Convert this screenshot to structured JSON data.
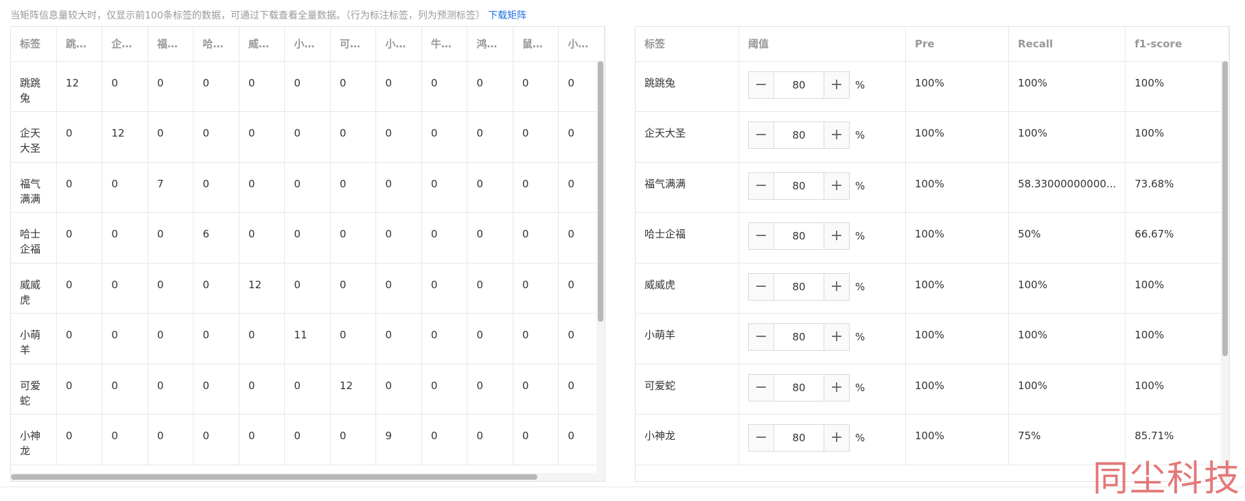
{
  "notice": {
    "text": "当矩阵信息量较大时，仅显示前100条标签的数据，可通过下载查看全量数据。（行为标注标签，列为预测标签）",
    "link": "下载矩阵"
  },
  "matrix": {
    "header_label": "标签",
    "columns": [
      "跳…",
      "企…",
      "福…",
      "哈…",
      "威…",
      "小…",
      "可…",
      "小…",
      "牛…",
      "鸿…",
      "鼠…",
      "小…"
    ],
    "rows": [
      {
        "label": "跳跳兔",
        "values": [
          "12",
          "0",
          "0",
          "0",
          "0",
          "0",
          "0",
          "0",
          "0",
          "0",
          "0",
          "0"
        ]
      },
      {
        "label": "企天大圣",
        "values": [
          "0",
          "12",
          "0",
          "0",
          "0",
          "0",
          "0",
          "0",
          "0",
          "0",
          "0",
          "0"
        ]
      },
      {
        "label": "福气满满",
        "values": [
          "0",
          "0",
          "7",
          "0",
          "0",
          "0",
          "0",
          "0",
          "0",
          "0",
          "0",
          "0"
        ]
      },
      {
        "label": "哈士企福",
        "values": [
          "0",
          "0",
          "0",
          "6",
          "0",
          "0",
          "0",
          "0",
          "0",
          "0",
          "0",
          "0"
        ]
      },
      {
        "label": "威威虎",
        "values": [
          "0",
          "0",
          "0",
          "0",
          "12",
          "0",
          "0",
          "0",
          "0",
          "0",
          "0",
          "0"
        ]
      },
      {
        "label": "小萌羊",
        "values": [
          "0",
          "0",
          "0",
          "0",
          "0",
          "11",
          "0",
          "0",
          "0",
          "0",
          "0",
          "0"
        ]
      },
      {
        "label": "可爱蛇",
        "values": [
          "0",
          "0",
          "0",
          "0",
          "0",
          "0",
          "12",
          "0",
          "0",
          "0",
          "0",
          "0"
        ]
      },
      {
        "label": "小神龙",
        "values": [
          "0",
          "0",
          "0",
          "0",
          "0",
          "0",
          "0",
          "9",
          "0",
          "0",
          "0",
          "0"
        ]
      }
    ]
  },
  "metrics": {
    "headers": {
      "label": "标签",
      "threshold": "阈值",
      "pre": "Pre",
      "recall": "Recall",
      "f1": "f1-score"
    },
    "unit": "%",
    "rows": [
      {
        "label": "跳跳兔",
        "threshold": "80",
        "pre": "100%",
        "recall": "100%",
        "f1": "100%"
      },
      {
        "label": "企天大圣",
        "threshold": "80",
        "pre": "100%",
        "recall": "100%",
        "f1": "100%"
      },
      {
        "label": "福气满满",
        "threshold": "80",
        "pre": "100%",
        "recall": "58.33000000000...",
        "f1": "73.68%"
      },
      {
        "label": "哈士企福",
        "threshold": "80",
        "pre": "100%",
        "recall": "50%",
        "f1": "66.67%"
      },
      {
        "label": "威威虎",
        "threshold": "80",
        "pre": "100%",
        "recall": "100%",
        "f1": "100%"
      },
      {
        "label": "小萌羊",
        "threshold": "80",
        "pre": "100%",
        "recall": "100%",
        "f1": "100%"
      },
      {
        "label": "可爱蛇",
        "threshold": "80",
        "pre": "100%",
        "recall": "100%",
        "f1": "100%"
      },
      {
        "label": "小神龙",
        "threshold": "80",
        "pre": "100%",
        "recall": "75%",
        "f1": "85.71%"
      }
    ]
  },
  "icons": {
    "minus": "minus-icon",
    "plus": "plus-icon"
  },
  "watermark": "同尘科技",
  "colors": {
    "link": "#1f6fe5",
    "watermark": "#e26a6a"
  }
}
